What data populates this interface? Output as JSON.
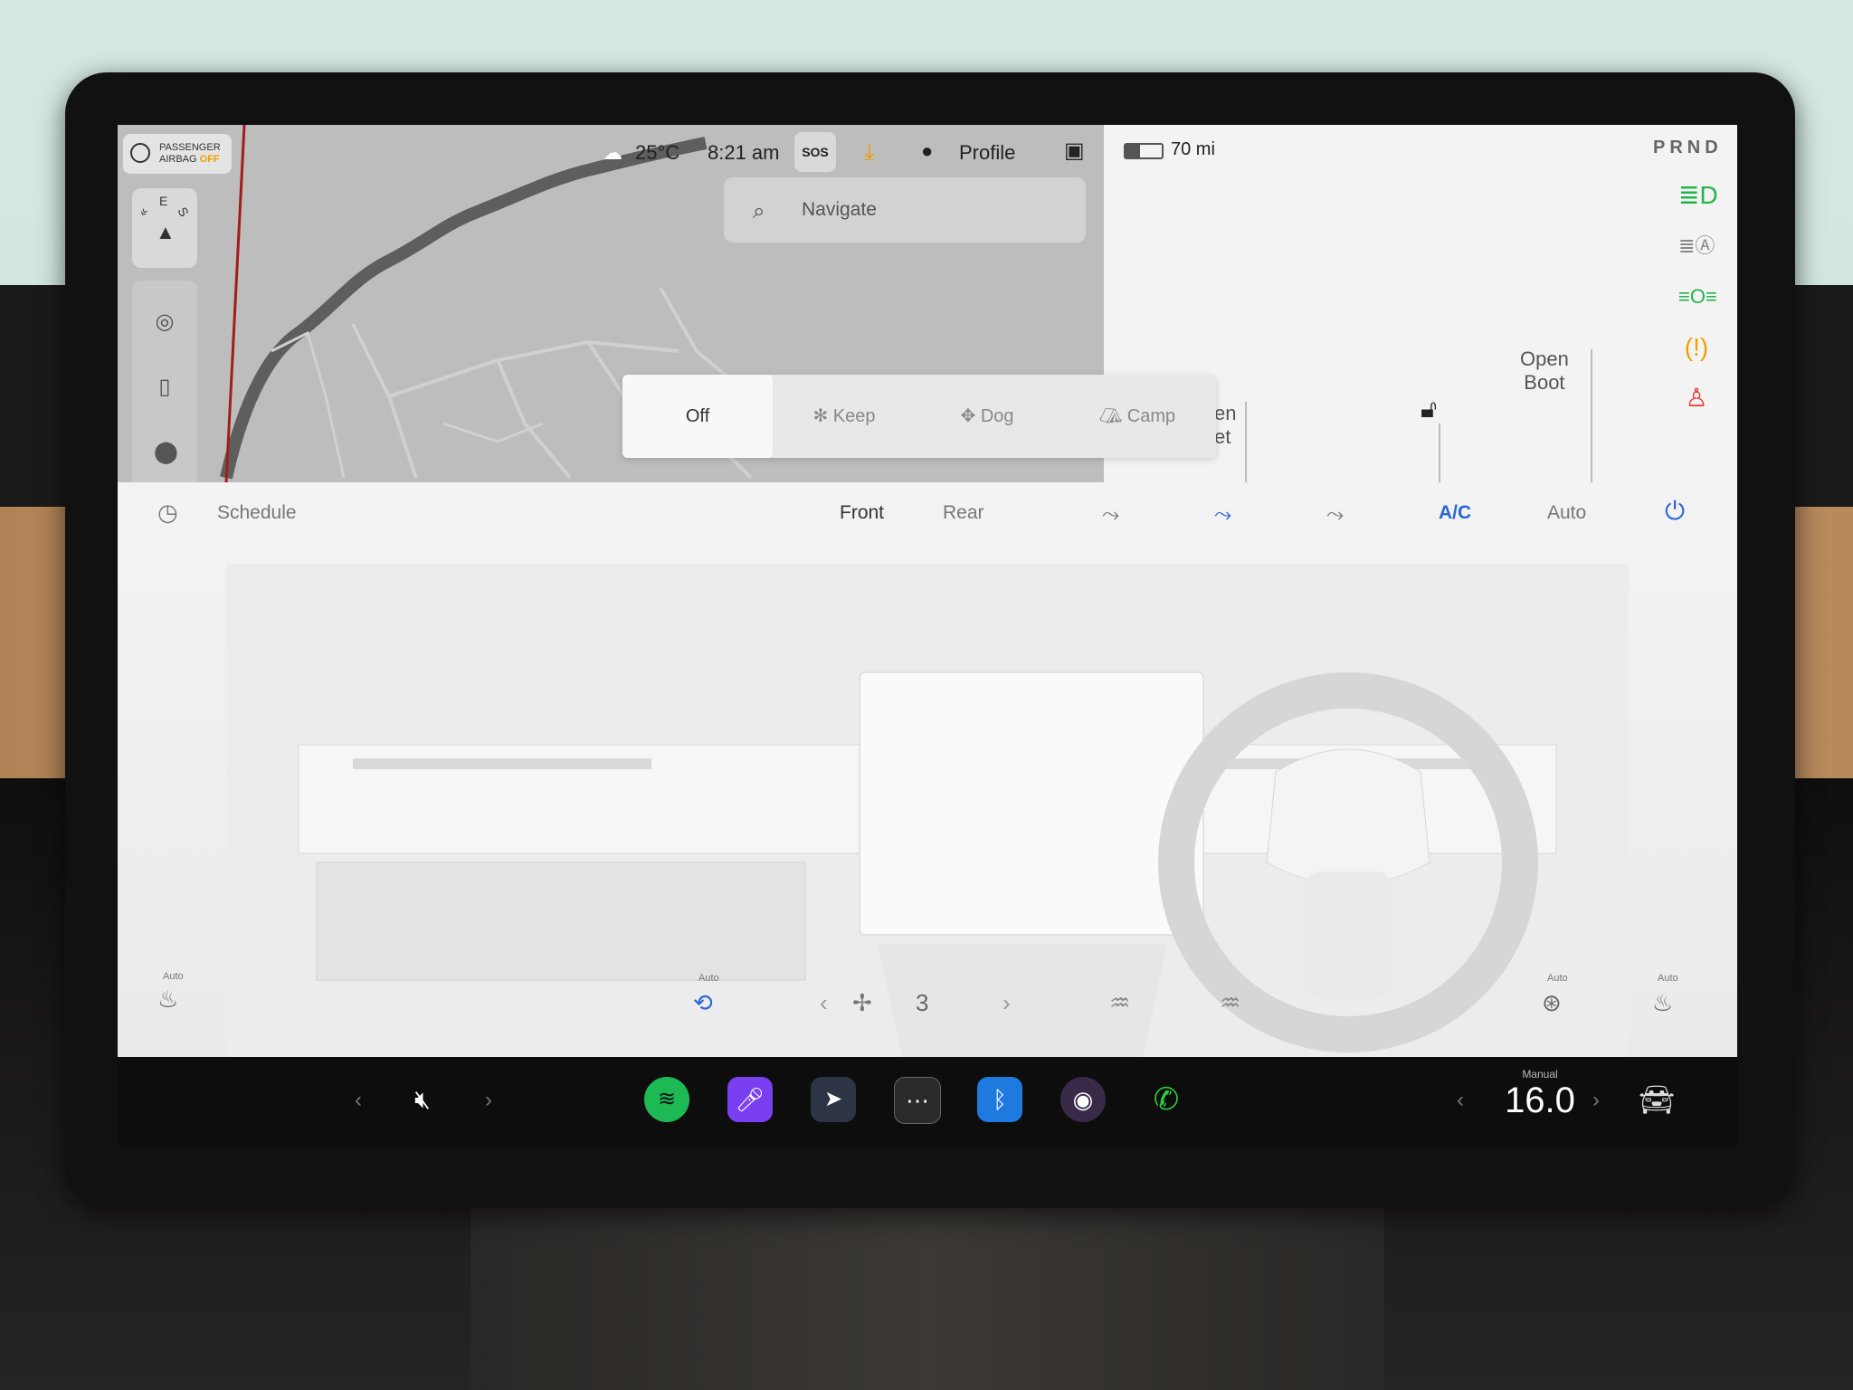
{
  "topbar": {
    "airbag_line1": "PASSENGER",
    "airbag_line2": "AIRBAG",
    "airbag_status": "OFF",
    "weather_temp": "25°C",
    "time": "8:21 am",
    "sos_label": "SOS",
    "profile_label": "Profile",
    "range": "70 mi",
    "gear": "PRND"
  },
  "compass": {
    "letters": [
      "E",
      "S"
    ]
  },
  "search": {
    "placeholder": "Navigate"
  },
  "modes": {
    "items": [
      "Off",
      "Keep",
      "Dog",
      "Camp"
    ],
    "active": "Off"
  },
  "quick": {
    "open_partial_1": "en",
    "open_partial_2": "et",
    "open_boot_1": "Open",
    "open_boot_2": "Boot"
  },
  "climate": {
    "schedule_label": "Schedule",
    "front_label": "Front",
    "rear_label": "Rear",
    "ac_label": "A/C",
    "auto_label": "Auto",
    "fan_speed": "3",
    "auto_small": "Auto"
  },
  "dock": {
    "temp_mode": "Manual",
    "temp_value": "16.0"
  },
  "colors": {
    "accent_blue": "#2a64d6",
    "spotify_green": "#1db954",
    "phone_green": "#2ecc40",
    "warning_orange": "#f0a000",
    "alert_red": "#e53935",
    "lamp_green": "#21b54c"
  }
}
